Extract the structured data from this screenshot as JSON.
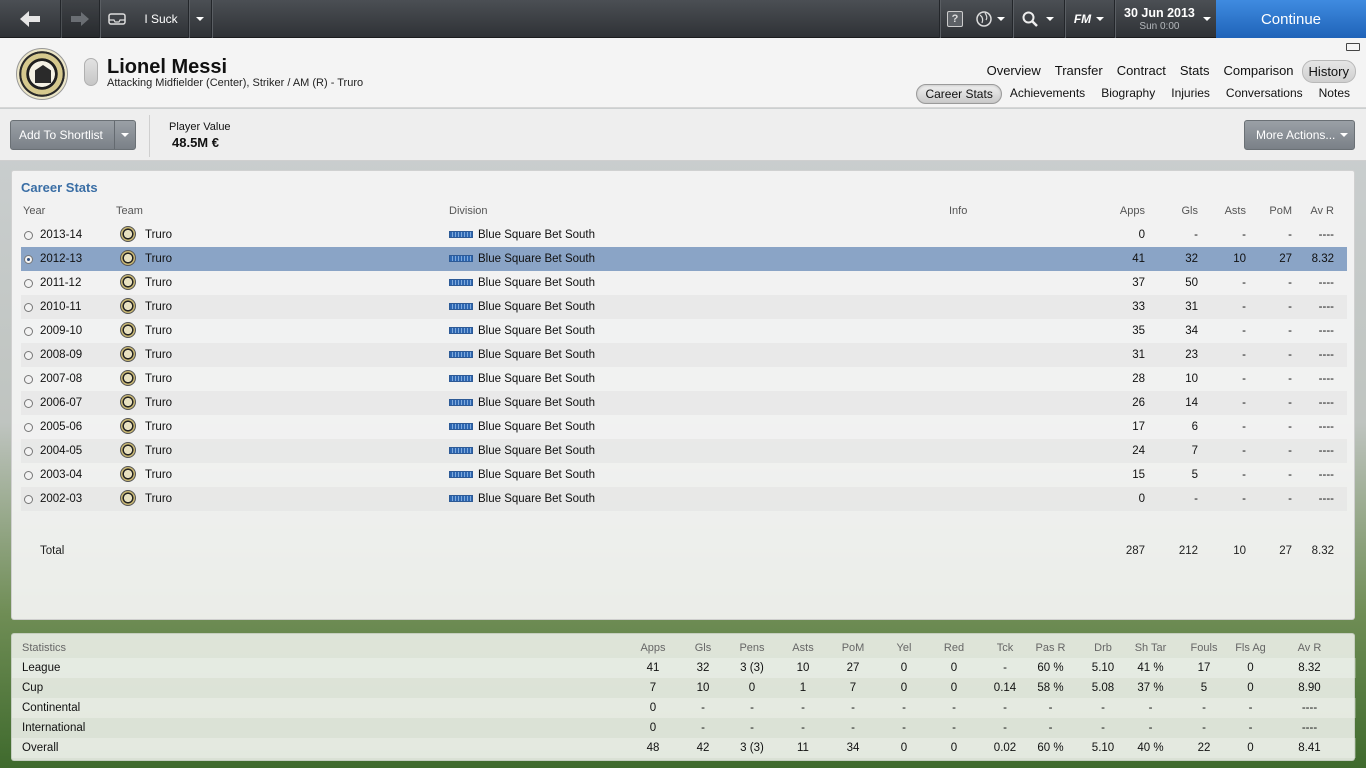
{
  "topbar": {
    "back_icon": "back-arrow-icon",
    "forward_icon": "forward-arrow-icon",
    "user_label": "I Suck",
    "date": "30 Jun 2013",
    "day_time": "Sun 0:00",
    "continue_label": "Continue",
    "fm_label": "FM",
    "help_label": "?"
  },
  "player": {
    "name": "Lionel Messi",
    "subtitle": "Attacking Midfielder (Center), Striker / AM (R) - Truro"
  },
  "nav_main": [
    "Overview",
    "Transfer",
    "Contract",
    "Stats",
    "Comparison",
    "History"
  ],
  "nav_main_active": "History",
  "nav_sub": [
    "Career Stats",
    "Achievements",
    "Biography",
    "Injuries",
    "Conversations",
    "Notes"
  ],
  "nav_sub_active": "Career Stats",
  "toolbar": {
    "shortlist_label": "Add To Shortlist",
    "player_value_label": "Player Value",
    "player_value": "48.5M €",
    "more_actions_label": "More Actions..."
  },
  "career": {
    "title": "Career Stats",
    "headers": {
      "year": "Year",
      "team": "Team",
      "division": "Division",
      "info": "Info",
      "apps": "Apps",
      "gls": "Gls",
      "asts": "Asts",
      "pom": "PoM",
      "avr": "Av R"
    },
    "rows": [
      {
        "year": "2013-14",
        "team": "Truro",
        "division": "Blue Square Bet South",
        "apps": "0",
        "gls": "-",
        "asts": "-",
        "pom": "-",
        "avr": "----"
      },
      {
        "year": "2012-13",
        "team": "Truro",
        "division": "Blue Square Bet South",
        "apps": "41",
        "gls": "32",
        "asts": "10",
        "pom": "27",
        "avr": "8.32"
      },
      {
        "year": "2011-12",
        "team": "Truro",
        "division": "Blue Square Bet South",
        "apps": "37",
        "gls": "50",
        "asts": "-",
        "pom": "-",
        "avr": "----"
      },
      {
        "year": "2010-11",
        "team": "Truro",
        "division": "Blue Square Bet South",
        "apps": "33",
        "gls": "31",
        "asts": "-",
        "pom": "-",
        "avr": "----"
      },
      {
        "year": "2009-10",
        "team": "Truro",
        "division": "Blue Square Bet South",
        "apps": "35",
        "gls": "34",
        "asts": "-",
        "pom": "-",
        "avr": "----"
      },
      {
        "year": "2008-09",
        "team": "Truro",
        "division": "Blue Square Bet South",
        "apps": "31",
        "gls": "23",
        "asts": "-",
        "pom": "-",
        "avr": "----"
      },
      {
        "year": "2007-08",
        "team": "Truro",
        "division": "Blue Square Bet South",
        "apps": "28",
        "gls": "10",
        "asts": "-",
        "pom": "-",
        "avr": "----"
      },
      {
        "year": "2006-07",
        "team": "Truro",
        "division": "Blue Square Bet South",
        "apps": "26",
        "gls": "14",
        "asts": "-",
        "pom": "-",
        "avr": "----"
      },
      {
        "year": "2005-06",
        "team": "Truro",
        "division": "Blue Square Bet South",
        "apps": "17",
        "gls": "6",
        "asts": "-",
        "pom": "-",
        "avr": "----"
      },
      {
        "year": "2004-05",
        "team": "Truro",
        "division": "Blue Square Bet South",
        "apps": "24",
        "gls": "7",
        "asts": "-",
        "pom": "-",
        "avr": "----"
      },
      {
        "year": "2003-04",
        "team": "Truro",
        "division": "Blue Square Bet South",
        "apps": "15",
        "gls": "5",
        "asts": "-",
        "pom": "-",
        "avr": "----"
      },
      {
        "year": "2002-03",
        "team": "Truro",
        "division": "Blue Square Bet South",
        "apps": "0",
        "gls": "-",
        "asts": "-",
        "pom": "-",
        "avr": "----"
      }
    ],
    "selected_row": 1,
    "total": {
      "label": "Total",
      "apps": "287",
      "gls": "212",
      "asts": "10",
      "pom": "27",
      "avr": "8.32"
    }
  },
  "statistics": {
    "headers": [
      "Statistics",
      "Apps",
      "Gls",
      "Pens",
      "Asts",
      "PoM",
      "Yel",
      "Red",
      "Tck",
      "Pas R",
      "Drb",
      "Sh Tar",
      "Fouls",
      "Fls Ag",
      "Av R"
    ],
    "rows": [
      [
        "League",
        "41",
        "32",
        "3 (3)",
        "10",
        "27",
        "0",
        "0",
        "-",
        "60 %",
        "5.10",
        "41 %",
        "17",
        "0",
        "8.32"
      ],
      [
        "Cup",
        "7",
        "10",
        "0",
        "1",
        "7",
        "0",
        "0",
        "0.14",
        "58 %",
        "5.08",
        "37 %",
        "5",
        "0",
        "8.90"
      ],
      [
        "Continental",
        "0",
        "-",
        "-",
        "-",
        "-",
        "-",
        "-",
        "-",
        "-",
        "-",
        "-",
        "-",
        "-",
        "----"
      ],
      [
        "International",
        "0",
        "-",
        "-",
        "-",
        "-",
        "-",
        "-",
        "-",
        "-",
        "-",
        "-",
        "-",
        "-",
        "----"
      ],
      [
        "Overall",
        "48",
        "42",
        "3 (3)",
        "11",
        "34",
        "0",
        "0",
        "0.02",
        "60 %",
        "5.10",
        "40 %",
        "22",
        "0",
        "8.41"
      ]
    ]
  }
}
